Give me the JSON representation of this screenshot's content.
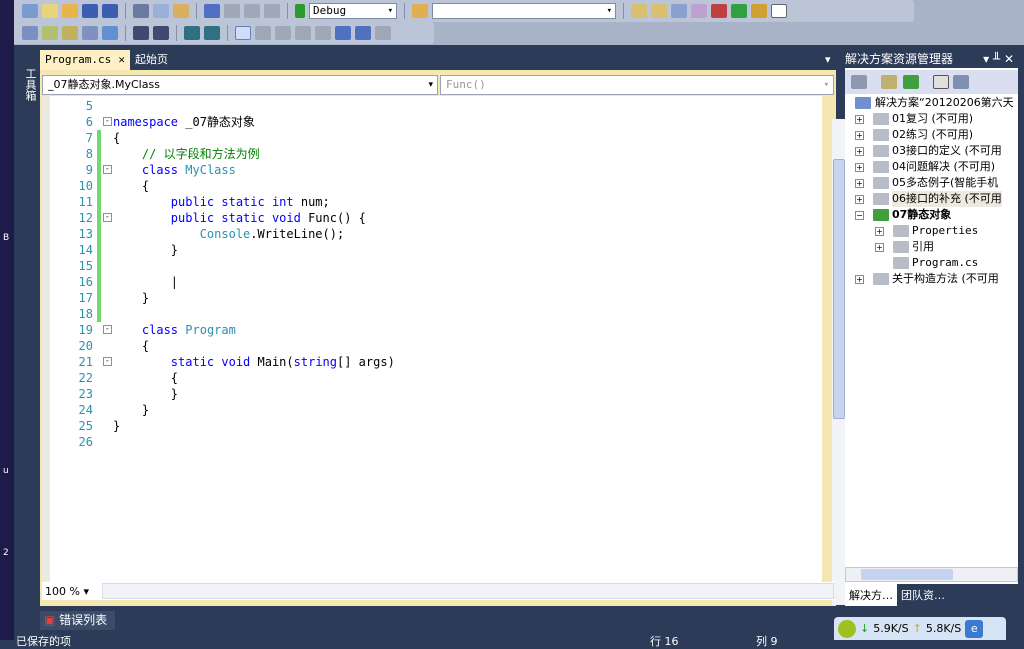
{
  "left_strip_letters": [
    "B",
    "u",
    "2"
  ],
  "toolbar": {
    "config": "Debug",
    "search": ""
  },
  "toolbox_label": "工具箱",
  "tabs": [
    {
      "label": "Program.cs",
      "close": "✕"
    },
    {
      "label": "起始页"
    }
  ],
  "navbar": {
    "type": "_07静态对象.MyClass",
    "member": "Func()"
  },
  "code": [
    {
      "n": "5",
      "t": []
    },
    {
      "n": "6",
      "fold": "-",
      "t": [
        [
          "kw",
          "namespace"
        ],
        [
          "pl",
          " _07静态对象"
        ]
      ]
    },
    {
      "n": "7",
      "chg": true,
      "t": [
        [
          "pl",
          "{"
        ]
      ]
    },
    {
      "n": "8",
      "chg": true,
      "t": [
        [
          "cm",
          "    // 以字段和方法为例"
        ]
      ]
    },
    {
      "n": "9",
      "chg": true,
      "fold": "-",
      "t": [
        [
          "pl",
          "    "
        ],
        [
          "kw",
          "class"
        ],
        [
          "pl",
          " "
        ],
        [
          "ty",
          "MyClass"
        ]
      ]
    },
    {
      "n": "10",
      "chg": true,
      "t": [
        [
          "pl",
          "    {"
        ]
      ]
    },
    {
      "n": "11",
      "chg": true,
      "t": [
        [
          "pl",
          "        "
        ],
        [
          "kw",
          "public static int"
        ],
        [
          "pl",
          " num;"
        ]
      ]
    },
    {
      "n": "12",
      "chg": true,
      "fold": "-",
      "t": [
        [
          "pl",
          "        "
        ],
        [
          "kw",
          "public static void"
        ],
        [
          "pl",
          " Func() {"
        ]
      ]
    },
    {
      "n": "13",
      "chg": true,
      "t": [
        [
          "pl",
          "            "
        ],
        [
          "ty",
          "Console"
        ],
        [
          "pl",
          ".WriteLine();"
        ]
      ]
    },
    {
      "n": "14",
      "chg": true,
      "t": [
        [
          "pl",
          "        }"
        ]
      ]
    },
    {
      "n": "15",
      "chg": true,
      "t": []
    },
    {
      "n": "16",
      "chg": true,
      "t": [
        [
          "pl",
          "        |"
        ]
      ]
    },
    {
      "n": "17",
      "chg": true,
      "t": [
        [
          "pl",
          "    }"
        ]
      ]
    },
    {
      "n": "18",
      "chg": true,
      "t": []
    },
    {
      "n": "19",
      "fold": "-",
      "t": [
        [
          "pl",
          "    "
        ],
        [
          "kw",
          "class"
        ],
        [
          "pl",
          " "
        ],
        [
          "ty",
          "Program"
        ]
      ]
    },
    {
      "n": "20",
      "t": [
        [
          "pl",
          "    {"
        ]
      ]
    },
    {
      "n": "21",
      "fold": "-",
      "t": [
        [
          "pl",
          "        "
        ],
        [
          "kw",
          "static void"
        ],
        [
          "pl",
          " Main("
        ],
        [
          "kw",
          "string"
        ],
        [
          "pl",
          "[] args)"
        ]
      ]
    },
    {
      "n": "22",
      "t": [
        [
          "pl",
          "        {"
        ]
      ]
    },
    {
      "n": "23",
      "t": [
        [
          "pl",
          "        }"
        ]
      ]
    },
    {
      "n": "24",
      "t": [
        [
          "pl",
          "    }"
        ]
      ]
    },
    {
      "n": "25",
      "t": [
        [
          "pl",
          "}"
        ]
      ]
    },
    {
      "n": "26",
      "t": []
    }
  ],
  "zoom": "100 %",
  "solution_explorer": {
    "title": "解决方案资源管理器",
    "controls": "▾ ╨ ✕",
    "tree": [
      {
        "label": "解决方案“20120206第六天",
        "level": 0
      },
      {
        "label": "01复习 (不可用)",
        "level": 1,
        "pm": "+"
      },
      {
        "label": "02练习 (不可用)",
        "level": 1,
        "pm": "+"
      },
      {
        "label": "03接口的定义 (不可用",
        "level": 1,
        "pm": "+"
      },
      {
        "label": "04问题解决 (不可用)",
        "level": 1,
        "pm": "+"
      },
      {
        "label": "05多态例子(智能手机",
        "level": 1,
        "pm": "+"
      },
      {
        "label": "06接口的补充 (不可用",
        "level": 1,
        "pm": "+"
      },
      {
        "label": "07静态对象",
        "level": 1,
        "pm": "-",
        "bold": true
      },
      {
        "label": "Properties",
        "level": 2,
        "pm": "+",
        "mono": true
      },
      {
        "label": "引用",
        "level": 2,
        "pm": "+"
      },
      {
        "label": "Program.cs",
        "level": 2,
        "mono": true
      },
      {
        "label": "关于构造方法 (不可用",
        "level": 1,
        "pm": "+"
      }
    ],
    "tabs": [
      "解决方…",
      "团队资…"
    ]
  },
  "error_list": "错误列表",
  "status": {
    "left": "已保存的项",
    "line": "行 16",
    "col": "列 9"
  },
  "net": {
    "down": "5.9K/S",
    "up": "5.8K/S"
  },
  "colors": {
    "keyword": "#0000ff",
    "type": "#2b91af",
    "comment": "#008000",
    "changed": "#6fd86f"
  }
}
